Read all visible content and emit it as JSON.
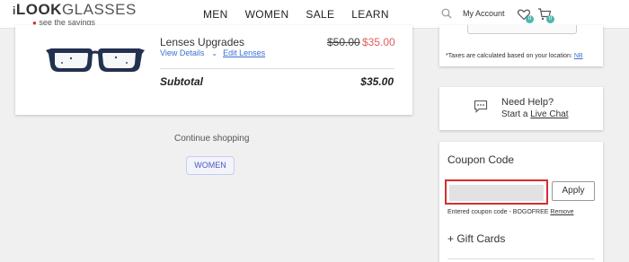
{
  "header": {
    "logo": {
      "prefix": "i",
      "look": "LOOK",
      "glasses": "GLASSES",
      "tagline": "see the savings"
    },
    "nav": [
      "MEN",
      "WOMEN",
      "SALE",
      "LEARN"
    ],
    "my_account": "My Account",
    "wishlist_count": "0",
    "cart_count": "0"
  },
  "cart_item": {
    "name": "Lenses Upgrades",
    "view_details": "View Details",
    "edit_lenses": "Edit Lenses",
    "price_original": "$50.00",
    "price_current": "$35.00",
    "subtotal_label": "Subtotal",
    "subtotal_value": "$35.00"
  },
  "continue_shopping": {
    "text": "Continue shopping",
    "button": "WOMEN"
  },
  "summary": {
    "tax_note": "*Taxes are calculated based on your location:",
    "tax_location": "NB"
  },
  "help": {
    "title": "Need Help?",
    "start_prefix": "Start a",
    "live_chat": "Live Chat"
  },
  "coupon": {
    "title": "Coupon Code",
    "input_value": "",
    "apply": "Apply",
    "applied_text": "Entered coupon code - BOGOFREE",
    "remove": "Remove",
    "gift_cards": "+ Gift Cards"
  },
  "colors": {
    "accent_red": "#d32f2f",
    "sale_price": "#e35d5d",
    "link_blue": "#3b6fd1",
    "badge_teal": "#4db6ac"
  }
}
